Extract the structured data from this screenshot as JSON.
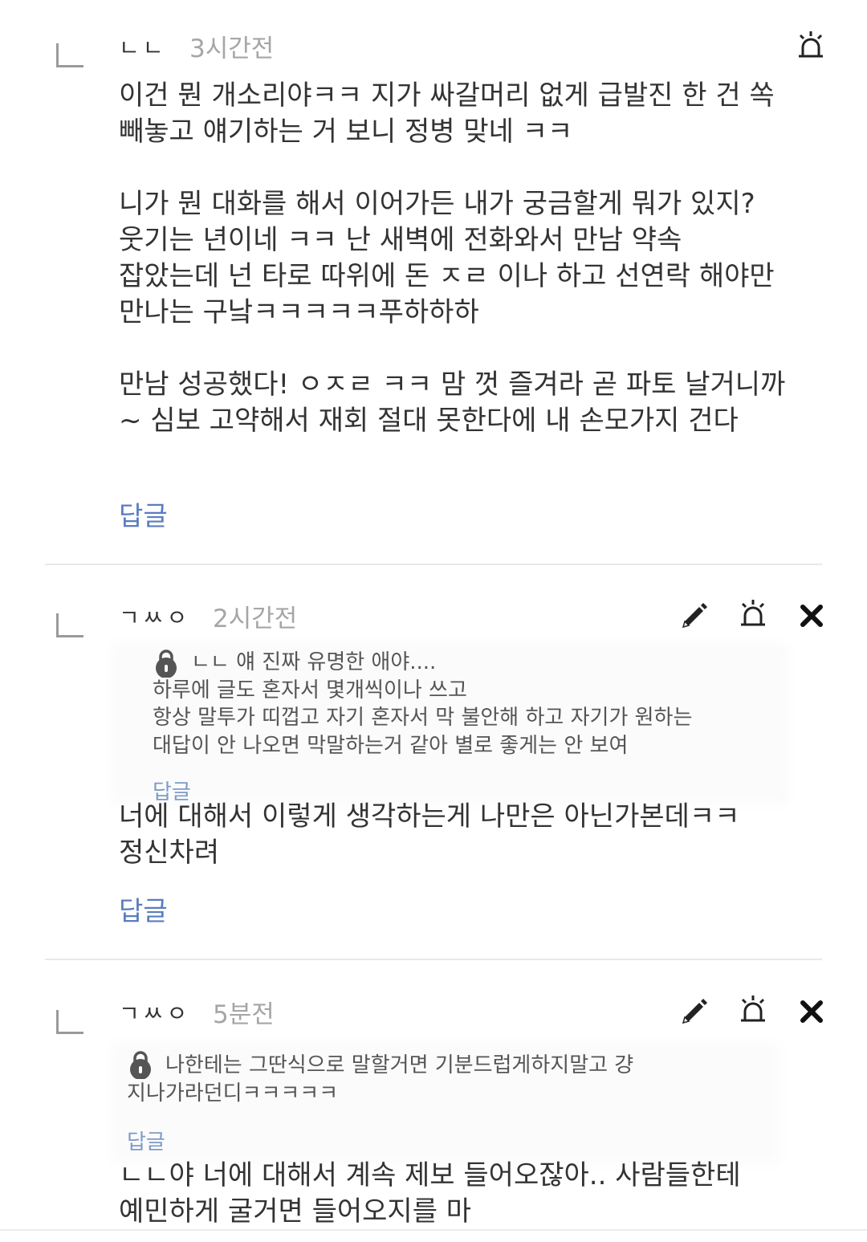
{
  "comments": [
    {
      "nickname": "ㄴㄴ",
      "time": "3시간전",
      "body": "이건 뭔 개소리야ㅋㅋ 지가 싸갈머리 없게 급발진 한 건 쏙\n빼놓고 얘기하는 거 보니 정병 맞네 ㅋㅋ\n\n니가 뭔 대화를 해서 이어가든 내가 궁금할게 뭐가 있지?\n웃기는 년이네 ㅋㅋ 난 새벽에 전화와서 만남 약속\n잡았는데 넌 타로 따위에 돈 ㅈㄹ 이나 하고 선연락 해야만\n만나는 구낰ㅋㅋㅋㅋㅋ푸하하하\n\n만남 성공했다! ㅇㅈㄹ ㅋㅋ 맘 껏 즐겨라 곧 파토 날거니까\n~ 심보 고약해서 재회 절대 못한다에 내 손모가지 건다",
      "reply_label": "답글"
    },
    {
      "nickname": "ㄱㅆㅇ",
      "time": "2시간전",
      "quote": {
        "text": "ㄴㄴ 얘 진짜 유명한 애야....\n하루에 글도 혼자서 몇개씩이나 쓰고\n항상 말투가 띠껍고 자기 혼자서 막 불안해 하고 자기가 원하는\n대답이 안 나오면 막말하는거 같아 별로 좋게는 안 보여",
        "reply_label": "답글"
      },
      "body": "너에 대해서 이렇게 생각하는게 나만은 아닌가본데ㅋㅋ\n정신차려",
      "reply_label": "답글"
    },
    {
      "nickname": "ㄱㅆㅇ",
      "time": "5분전",
      "quote": {
        "text": "나한테는 그딴식으로 말할거면 기분드럽게하지말고 걍\n지나가라던디ㅋㅋㅋㅋㅋ",
        "reply_label": "답글"
      },
      "body": "ㄴㄴ야 너에 대해서 계속 제보 들어오잖아.. 사람들한테\n예민하게 굴거면 들어오지를 마"
    }
  ],
  "icons": {
    "report": "siren-icon",
    "edit": "pencil-icon",
    "delete": "close-icon",
    "lock": "lock-icon"
  }
}
